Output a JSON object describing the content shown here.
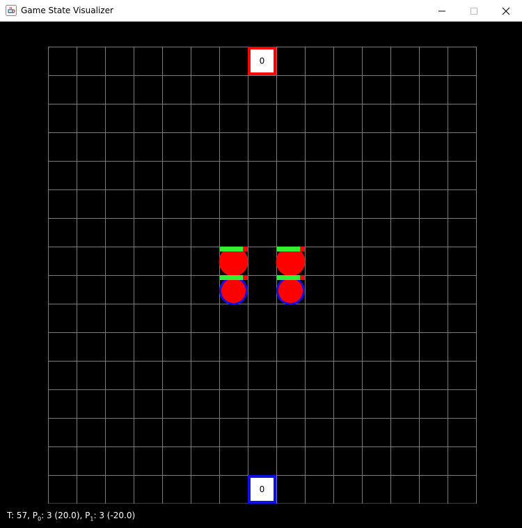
{
  "window": {
    "title": "Game State Visualizer"
  },
  "colors": {
    "grid": "#7a7a7a",
    "red_team": "#ff0000",
    "blue_team": "#1010e0",
    "health": "#33ee33"
  },
  "grid": {
    "cols": 15,
    "rows": 16
  },
  "bases": [
    {
      "team": "red",
      "value": "0",
      "col": 7,
      "row": 0
    },
    {
      "team": "blue",
      "value": "0",
      "col": 7,
      "row": 15
    }
  ],
  "units": [
    {
      "team": "red",
      "col": 6,
      "row": 7,
      "health_fraction": 0.83,
      "ring": false
    },
    {
      "team": "red",
      "col": 8,
      "row": 7,
      "health_fraction": 0.83,
      "ring": false
    },
    {
      "team": "red",
      "col": 6,
      "row": 8,
      "health_fraction": 0.83,
      "ring": true
    },
    {
      "team": "red",
      "col": 8,
      "row": 8,
      "health_fraction": 0.83,
      "ring": true
    }
  ],
  "status": {
    "turn_label": "T: 57, P",
    "p0_sub": "0",
    "p0_text": ": 3 (20.0), P",
    "p1_sub": "1",
    "p1_text": ": 3 (-20.0)"
  }
}
